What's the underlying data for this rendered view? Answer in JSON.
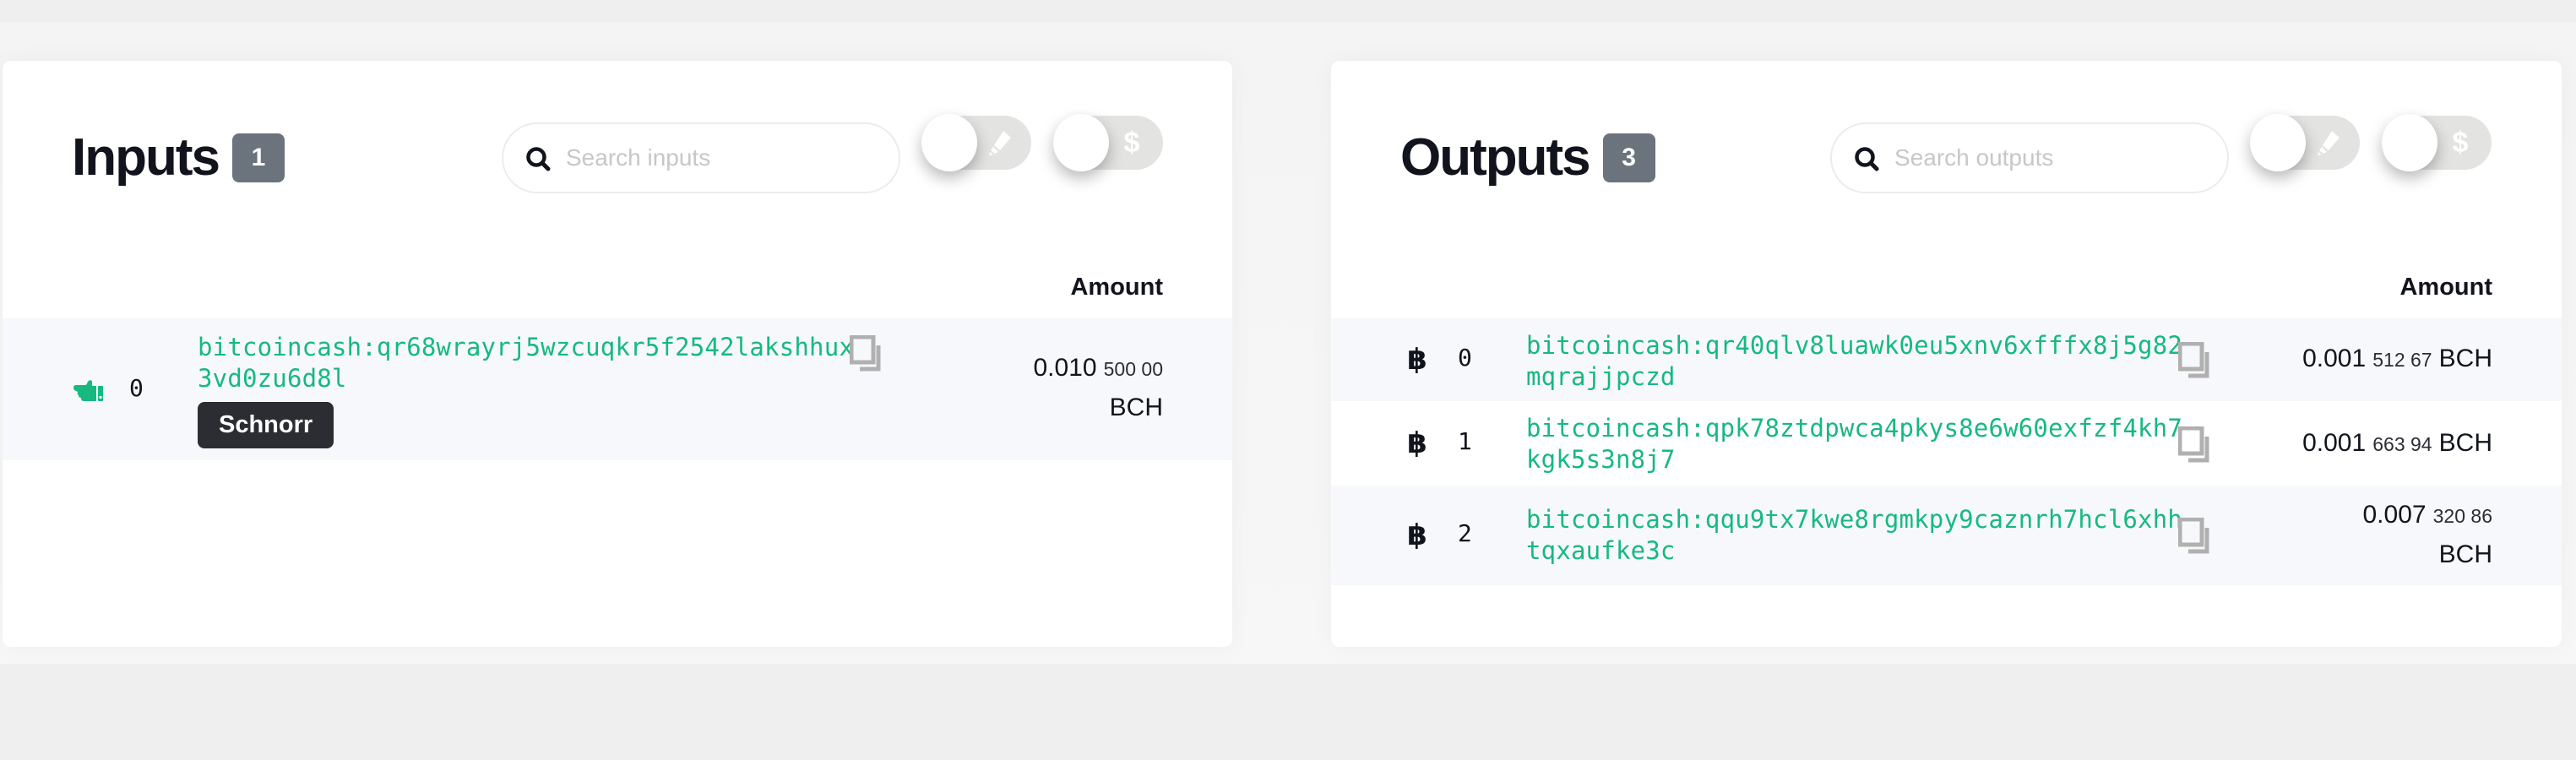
{
  "inputs": {
    "title": "Inputs",
    "count": "1",
    "search_placeholder": "Search inputs",
    "toggles": [
      {
        "name": "highlight",
        "icon": "highlighter-icon",
        "state": "off"
      },
      {
        "name": "fiat",
        "icon": "dollar-icon",
        "glyph": "$",
        "state": "off"
      }
    ],
    "amount_header": "Amount",
    "rows": [
      {
        "icon": "hand-point-left-icon",
        "index": "0",
        "address": "bitcoincash:qr68wrayrj5wzcuqkr5f2542lakshhux3vd0zu6d8l",
        "badge": "Schnorr",
        "amount_major": "0.010",
        "amount_minor": "500 00",
        "unit": "BCH"
      }
    ]
  },
  "outputs": {
    "title": "Outputs",
    "count": "3",
    "search_placeholder": "Search outputs",
    "toggles": [
      {
        "name": "highlight",
        "icon": "highlighter-icon",
        "state": "off"
      },
      {
        "name": "fiat",
        "icon": "dollar-icon",
        "glyph": "$",
        "state": "off"
      }
    ],
    "amount_header": "Amount",
    "rows": [
      {
        "icon": "bitcoin-icon",
        "index": "0",
        "address": "bitcoincash:qr40qlv8luawk0eu5xnv6xfffx8j5g82mqrajjpczd",
        "amount_major": "0.001",
        "amount_minor": "512 67",
        "unit": "BCH"
      },
      {
        "icon": "bitcoin-icon",
        "index": "1",
        "address": "bitcoincash:qpk78ztdpwca4pkys8e6w60exfzf4kh7kgk5s3n8j7",
        "amount_major": "0.001",
        "amount_minor": "663 94",
        "unit": "BCH"
      },
      {
        "icon": "bitcoin-icon",
        "index": "2",
        "address": "bitcoincash:qqu9tx7kwe8rgmkpy9caznrh7hcl6xhhtqxaufke3c",
        "amount_major": "0.007",
        "amount_minor": "320 86",
        "unit": "BCH"
      }
    ]
  },
  "colors": {
    "address": "#16b97f",
    "badge_bg": "#6b737c",
    "schnorr_bg": "#2b2d32",
    "row_alt_bg": "#f7f8fb",
    "toggle_track": "#e3e3e2"
  }
}
